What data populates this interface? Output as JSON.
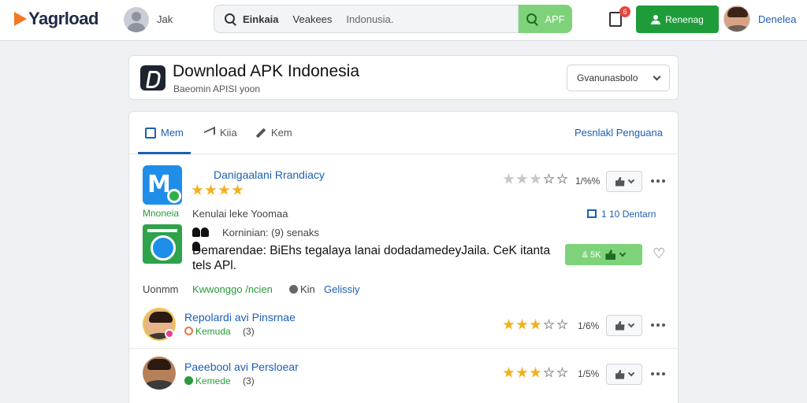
{
  "header": {
    "logo_text": "Yagrload",
    "user_name": "Jak",
    "search_chips": [
      "Einkaia",
      "Veakees",
      "Indonusia."
    ],
    "search_button_label": "APF",
    "notification_count": "6",
    "register_label": "Renenag",
    "profile_name": "Denelea"
  },
  "page_header": {
    "title": "Download APK Indonesia",
    "subtitle": "Baeomin APISI yoon",
    "sort_label": "Gvanunasbolo"
  },
  "tabs": {
    "items": [
      {
        "label": "Mem"
      },
      {
        "label": "Kiia"
      },
      {
        "label": "Kem"
      }
    ],
    "right_link": "Pesnlakl Penguana"
  },
  "app_row": {
    "name": "Danigaalani Rrandiacy",
    "star_count": 4,
    "rating_pct": "1/%%",
    "platform_label": "Mnoneia",
    "description": "Kenulai leke Yoomaa",
    "downloads": "1 10 Dentarn"
  },
  "post_row": {
    "meta": "Korninian: (9) senaks",
    "text": "Demarendae: BiEhs tegalaya lanai dodadamedeyJaila. CeK itanta tels APl.",
    "like_label": "& 5K",
    "author": "Uonmm",
    "category": "Kwwonggo /ncien",
    "tag": "Kin",
    "link": "Gelissiy"
  },
  "reviews": [
    {
      "name": "Repolardi avi Pinsrnae",
      "meta": "Kemuda",
      "count": "(3)",
      "rating_pct": "1/6%",
      "stars": 2.5
    },
    {
      "name": "Paeebool avi Persloear",
      "meta": "Kemede",
      "count": "(3)",
      "rating_pct": "1/5%",
      "stars": 2.5
    }
  ],
  "colors": {
    "brand_green": "#1f9c3a",
    "accent_blue": "#1c5fb4",
    "star_yellow": "#f2b01e",
    "search_green": "#7ed37a"
  }
}
